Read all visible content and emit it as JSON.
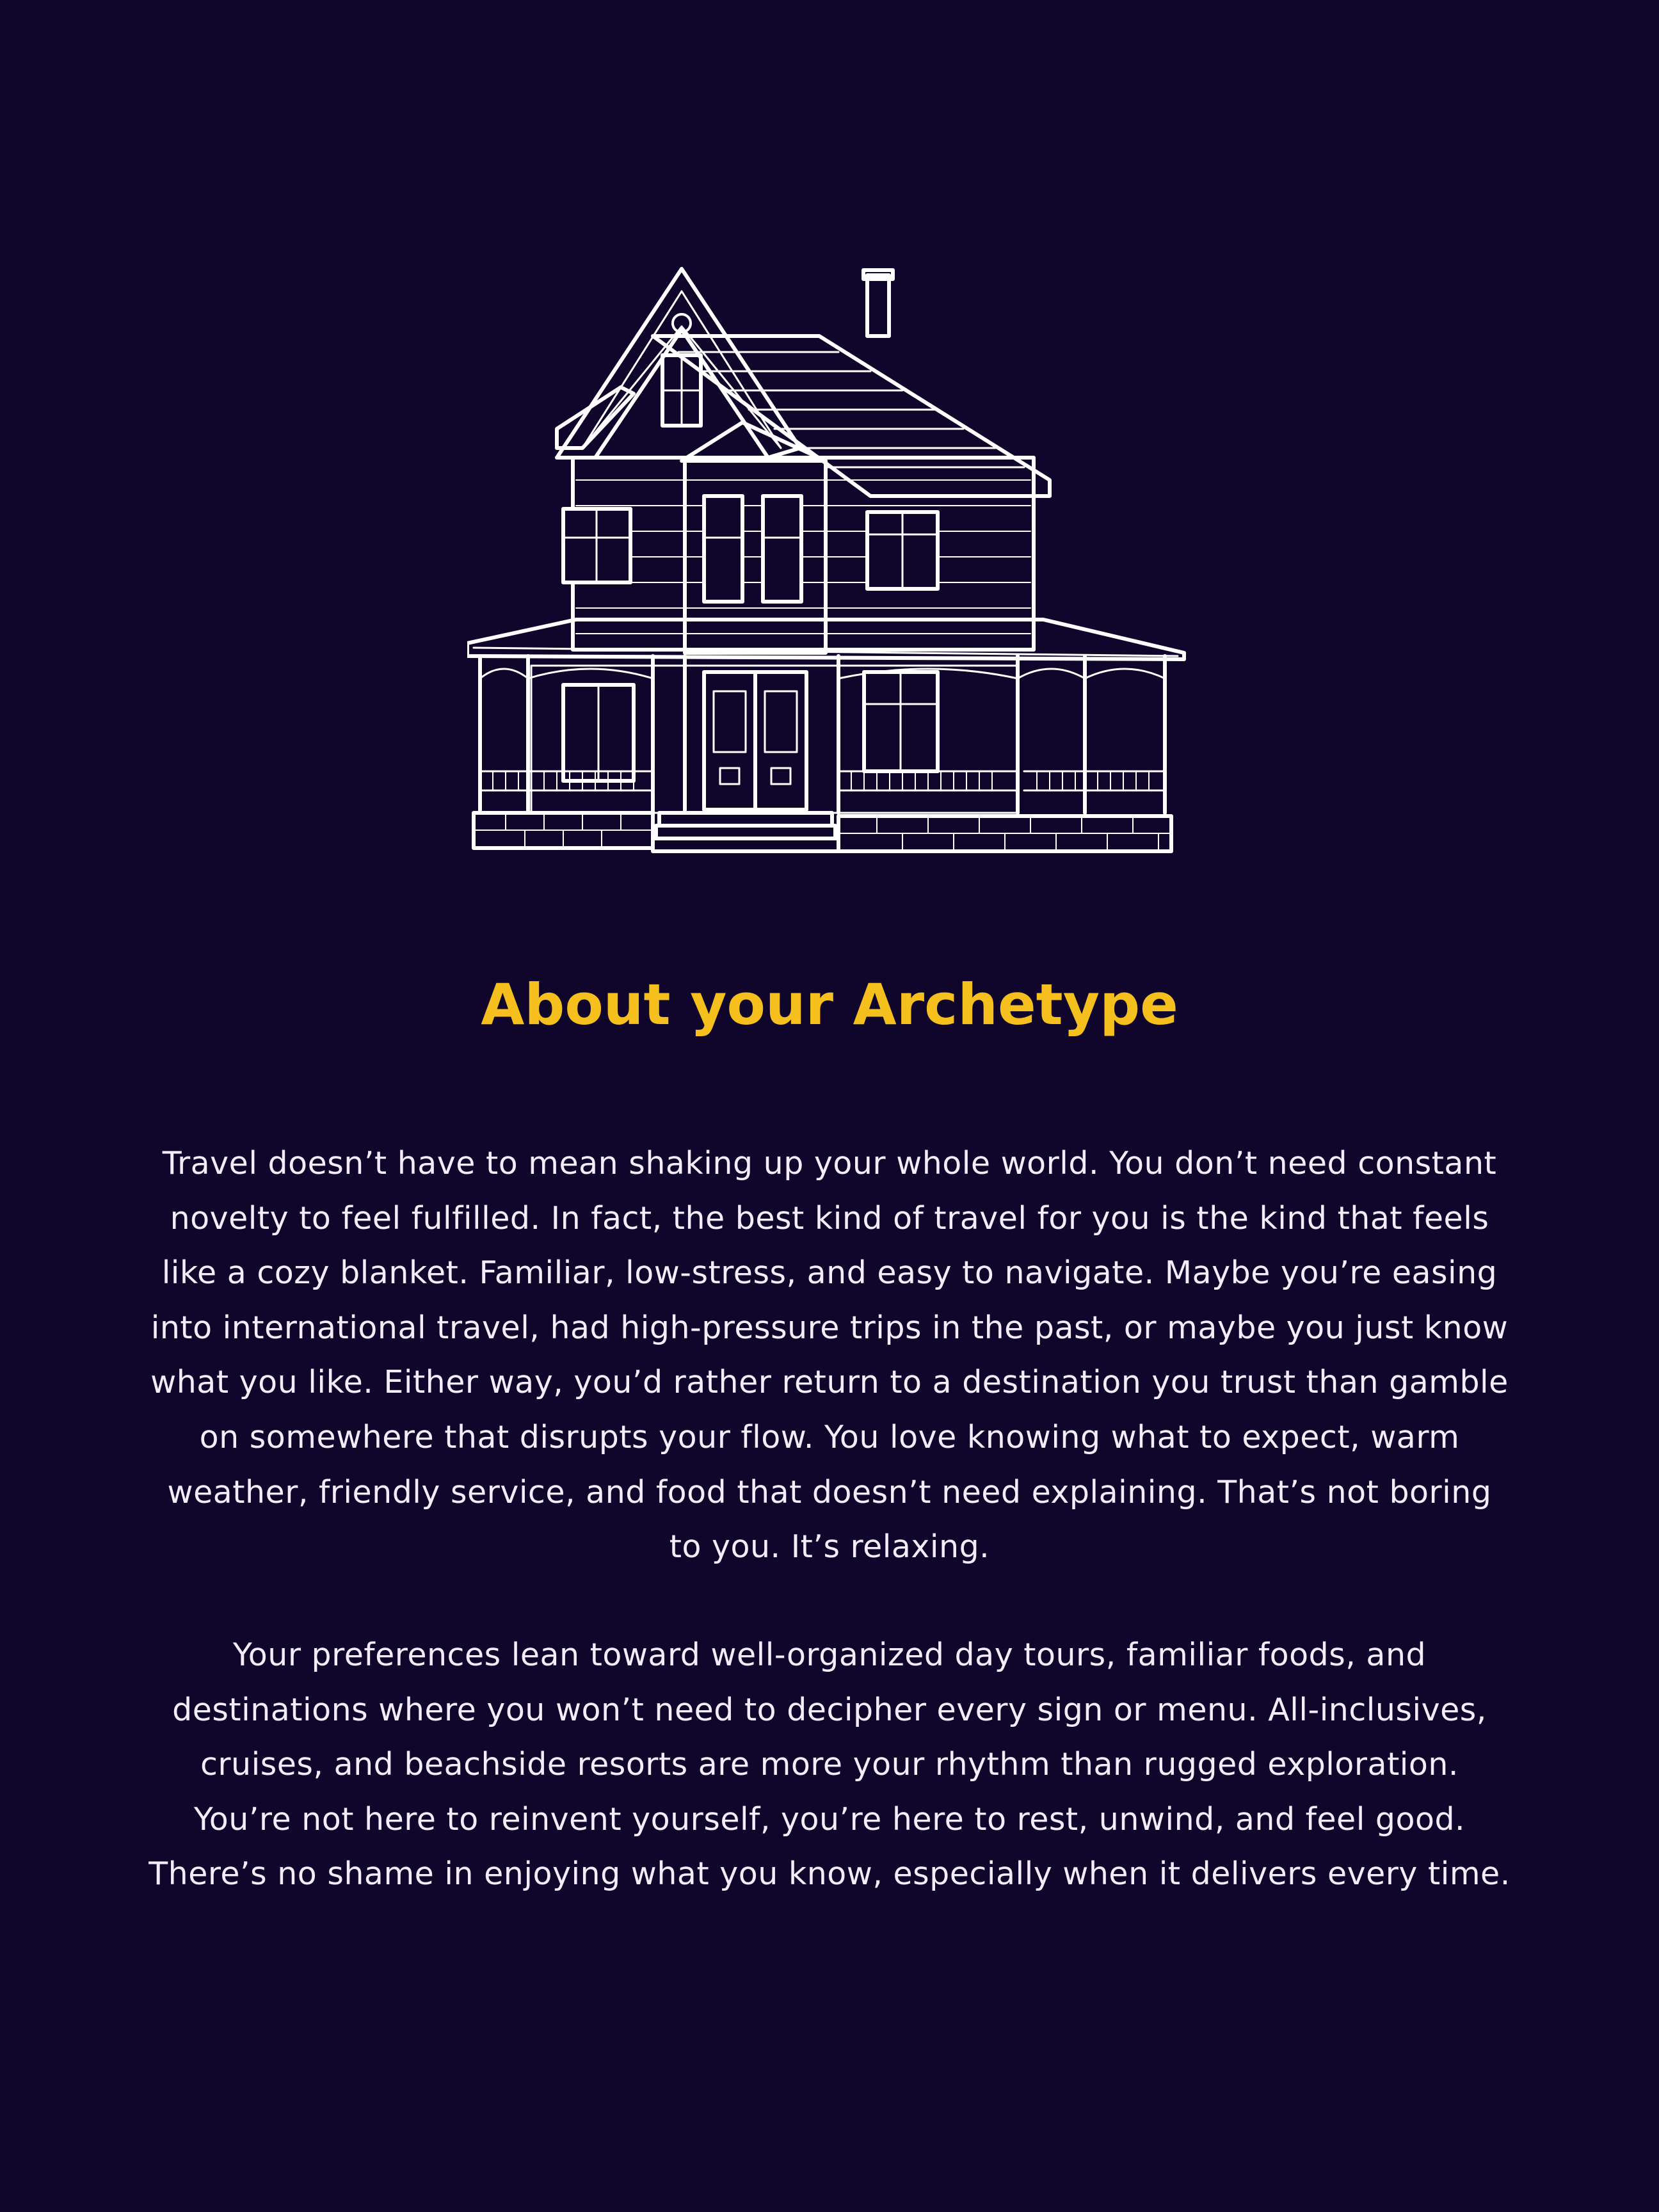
{
  "illustration": {
    "icon": "victorian-house-icon",
    "line_color": "#ffffff"
  },
  "heading": {
    "title": "About your Archetype",
    "color": "#f5c01e"
  },
  "paragraphs": [
    "Travel doesn’t have to mean shaking up your whole world. You don’t need constant novelty to feel fulfilled. In fact, the best kind of travel for you is the kind that feels like a cozy blanket. Familiar, low-stress, and easy to navigate. Maybe you’re easing into international travel, had high-pressure trips in the past, or maybe you just know what you like. Either way, you’d rather return to a destination you trust than gamble on somewhere that disrupts your flow. You love knowing what to expect, warm weather, friendly service, and food that doesn’t need explaining. That’s not boring to you. It’s relaxing.",
    "Your preferences lean toward well-organized day tours, familiar foods, and destinations where you won’t need to decipher every sign or menu. All-inclusives, cruises, and beachside resorts are more your rhythm than rugged exploration. You’re not here to reinvent yourself, you’re here to rest, unwind, and feel good. There’s no shame in enjoying what you know, especially when it delivers every time."
  ],
  "background_color": "#10062b"
}
